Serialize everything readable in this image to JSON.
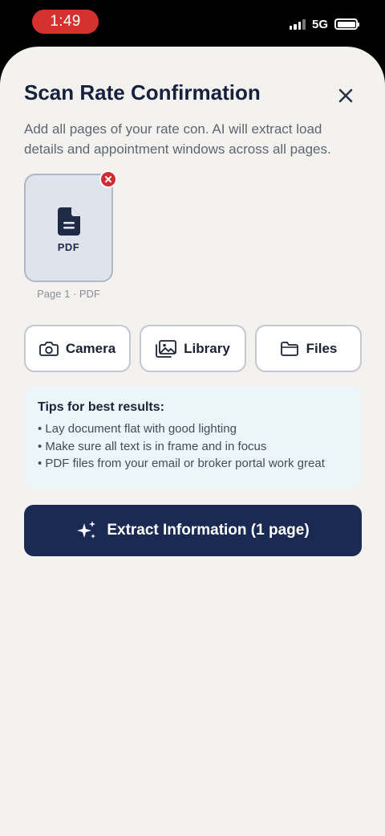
{
  "status_bar": {
    "time": "1:49",
    "network": "5G"
  },
  "sheet": {
    "title": "Scan Rate Confirmation",
    "subtitle": "Add all pages of your rate con. AI will extract load details and appointment windows across all pages."
  },
  "pages": [
    {
      "type_label": "PDF",
      "caption": "Page 1 · PDF"
    }
  ],
  "actions": {
    "camera": "Camera",
    "library": "Library",
    "files": "Files"
  },
  "tips": {
    "title": "Tips for best results:",
    "items": [
      "Lay document flat with good lighting",
      "Make sure all text is in frame and in focus",
      "PDF files from your email or broker portal work great"
    ]
  },
  "extract_button": "Extract Information (1 page)",
  "colors": {
    "primary": "#1a2a52",
    "remove": "#d12b34",
    "time_pill": "#d5322f",
    "sheet_bg": "#f3f2ee",
    "tips_bg": "#ecf5fa"
  }
}
